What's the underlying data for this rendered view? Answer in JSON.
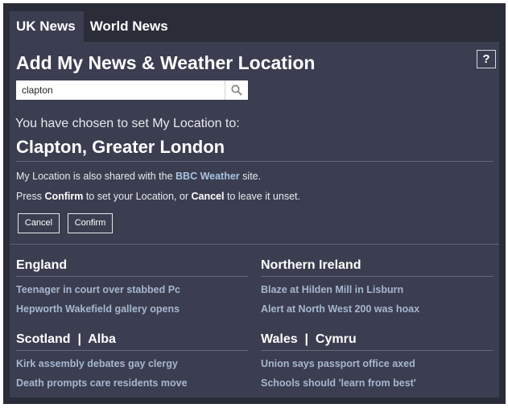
{
  "tabs": [
    {
      "label": "UK News",
      "active": true
    },
    {
      "label": "World News",
      "active": false
    }
  ],
  "panel": {
    "help_label": "?",
    "title": "Add My News & Weather Location",
    "search": {
      "value": "clapton",
      "icon": "search-icon"
    },
    "chosen_label": "You have chosen to set My Location to:",
    "location_name": "Clapton, Greater London",
    "shared_text_before": "My Location is also shared with the ",
    "shared_link": "BBC Weather",
    "shared_text_after": " site.",
    "instruction_before": "Press ",
    "instruction_confirm": "Confirm",
    "instruction_mid": " to set your Location, or ",
    "instruction_cancel": "Cancel",
    "instruction_after": " to leave it unset.",
    "cancel_button": "Cancel",
    "confirm_button": "Confirm"
  },
  "regions": [
    {
      "name": "England",
      "headlines": [
        "Teenager in court over stabbed Pc",
        "Hepworth Wakefield gallery opens"
      ]
    },
    {
      "name": "Northern Ireland",
      "headlines": [
        "Blaze at Hilden Mill in Lisburn",
        "Alert at North West 200 was hoax"
      ]
    },
    {
      "name": "Scotland  |  Alba",
      "headlines": [
        "Kirk assembly debates gay clergy",
        "Death prompts care residents move"
      ]
    },
    {
      "name": "Wales  |  Cymru",
      "headlines": [
        "Union says passport office axed",
        "Schools should 'learn from best'"
      ]
    }
  ],
  "colors": {
    "background": "#2a2c38",
    "panel": "#3b3e50",
    "link": "#a7b6cf"
  }
}
